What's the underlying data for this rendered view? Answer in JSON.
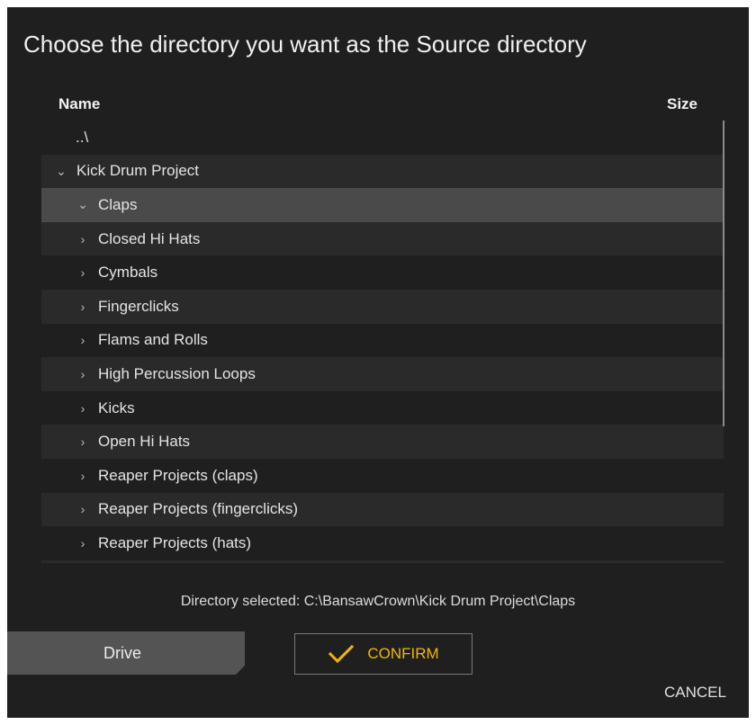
{
  "dialog": {
    "title": "Choose the directory you want as the Source directory"
  },
  "columns": {
    "name": "Name",
    "size": "Size"
  },
  "list": {
    "parent_label": "..\\",
    "root": {
      "label": "Kick Drum Project",
      "icon": "chevron-down-icon"
    },
    "items": [
      {
        "label": "Claps",
        "icon": "chevron-down-icon",
        "selected": true
      },
      {
        "label": "Closed Hi Hats",
        "icon": "chevron-right-icon"
      },
      {
        "label": "Cymbals",
        "icon": "chevron-right-icon"
      },
      {
        "label": "Fingerclicks",
        "icon": "chevron-right-icon"
      },
      {
        "label": "Flams and Rolls",
        "icon": "chevron-right-icon"
      },
      {
        "label": "High Percussion Loops",
        "icon": "chevron-right-icon"
      },
      {
        "label": "Kicks",
        "icon": "chevron-right-icon"
      },
      {
        "label": "Open Hi Hats",
        "icon": "chevron-right-icon"
      },
      {
        "label": "Reaper Projects (claps)",
        "icon": "chevron-right-icon"
      },
      {
        "label": "Reaper Projects (fingerclicks)",
        "icon": "chevron-right-icon"
      },
      {
        "label": "Reaper Projects (hats)",
        "icon": "chevron-right-icon"
      }
    ]
  },
  "status": {
    "text": "Directory selected: C:\\BansawCrown\\Kick Drum Project\\Claps"
  },
  "buttons": {
    "drive": "Drive",
    "confirm": "CONFIRM",
    "cancel": "CANCEL"
  },
  "colors": {
    "background": "#1f1f1f",
    "accent": "#f2b705",
    "selected_row": "#4a4a4a"
  }
}
